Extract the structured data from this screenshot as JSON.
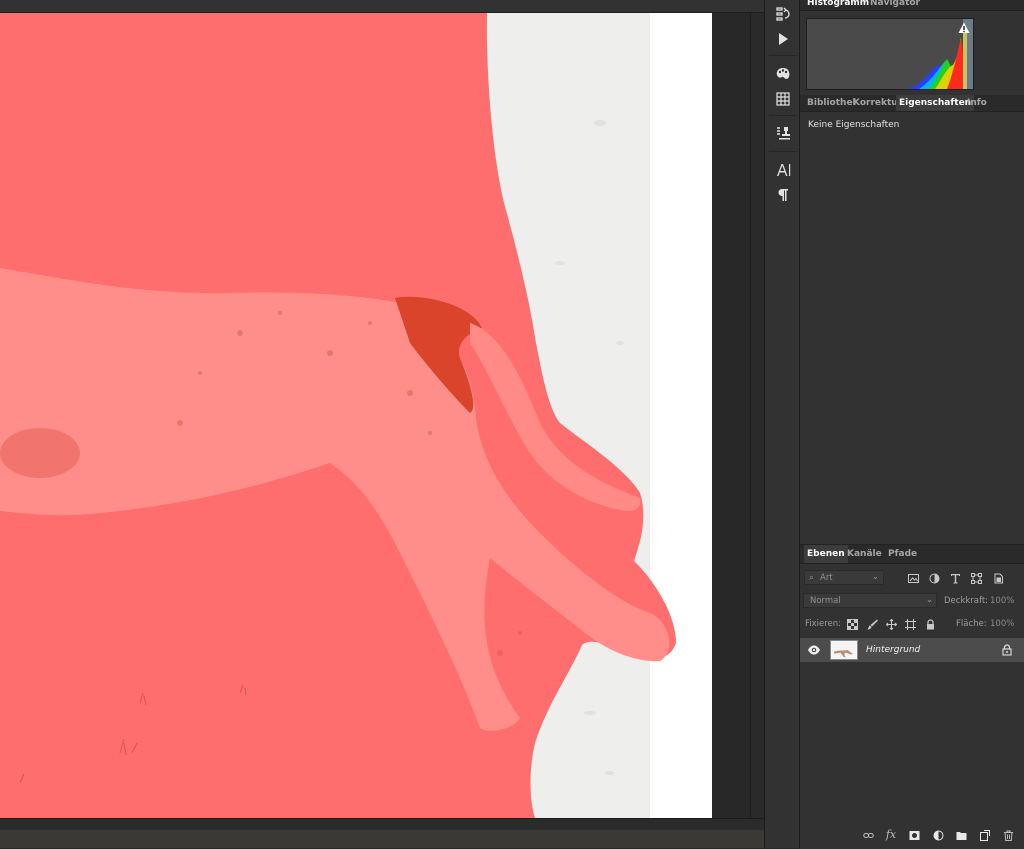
{
  "panels": {
    "top_tabs": [
      "Histogramm",
      "Navigator"
    ],
    "mid_tabs": [
      "Bibliothel",
      "Korrektur",
      "Eigenschaften",
      "Info"
    ],
    "properties_text": "Keine Eigenschaften",
    "histogram_warning_icon": "warning-icon"
  },
  "layers": {
    "tabs": [
      "Ebenen",
      "Kanäle",
      "Pfade"
    ],
    "filter_placeholder": "Art",
    "blend_mode": "Normal",
    "opacity_label": "Deckkraft:",
    "opacity_value": "100%",
    "lock_label": "Fixieren:",
    "fill_label": "Fläche:",
    "fill_value": "100%",
    "layer_name": "Hintergrund"
  },
  "colors": {
    "quickmask_overlay": "#ff6e6e",
    "panel_bg": "#323232",
    "selected_layer_bg": "#4c4c4c"
  }
}
